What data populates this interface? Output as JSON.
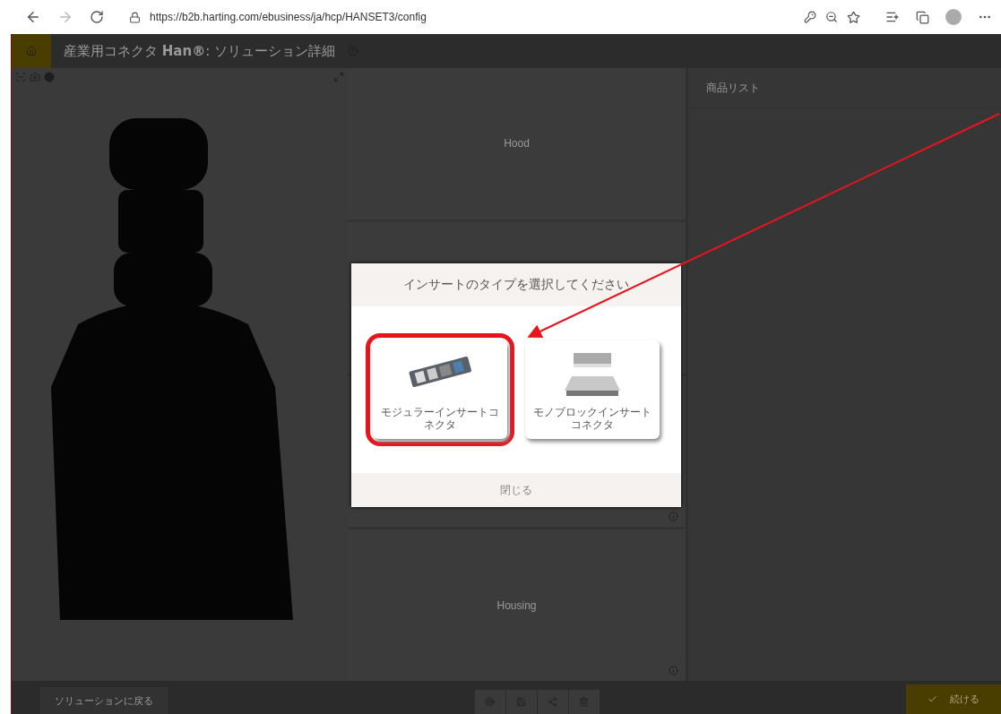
{
  "browser": {
    "url": "https://b2b.harting.com/ebusiness/ja/hcp/HANSET3/config"
  },
  "header": {
    "title": "産業用コネクタ **Han®**: ソリューション詳細"
  },
  "sections": [
    {
      "kind": "labeled",
      "label": "Hood"
    },
    {
      "kind": "empty"
    },
    {
      "kind": "empty",
      "info": true
    },
    {
      "kind": "labeled",
      "label": "Housing",
      "info": true
    }
  ],
  "product_list": {
    "title": "商品リスト"
  },
  "footer": {
    "back": "ソリューションに戻る",
    "continue": "続ける"
  },
  "dialog": {
    "title": "インサートのタイプを選択してください",
    "close": "閉じる",
    "options": [
      {
        "label": "モジュラーインサートコネクタ",
        "kind": "modular",
        "highlighted": true
      },
      {
        "label": "モノブロックインサートコネクタ",
        "kind": "monoblock",
        "highlighted": false
      }
    ]
  }
}
